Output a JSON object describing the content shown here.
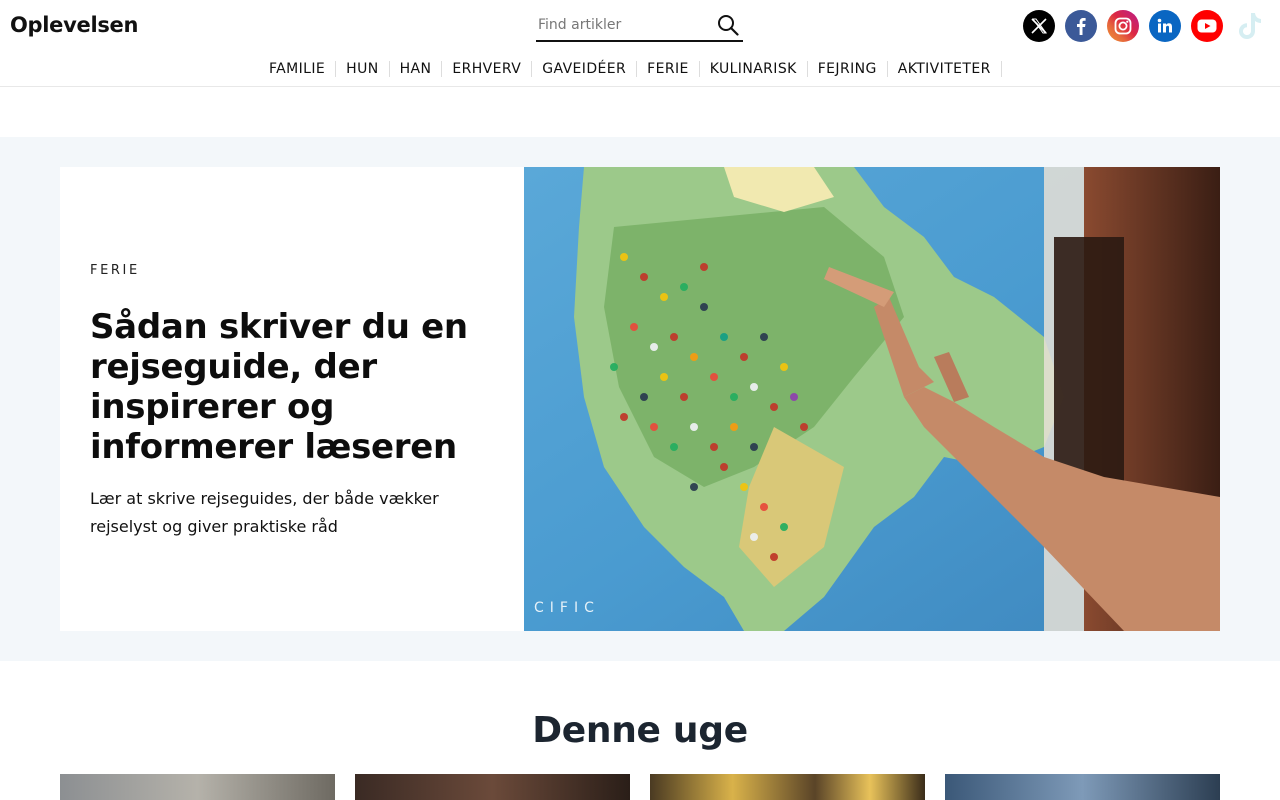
{
  "header": {
    "logo": "Oplevelsen",
    "search": {
      "placeholder": "Find artikler"
    },
    "social": [
      {
        "name": "x",
        "color": "#000000"
      },
      {
        "name": "facebook",
        "color": "#3b5998"
      },
      {
        "name": "instagram",
        "color": "#c13584"
      },
      {
        "name": "linkedin",
        "color": "#0a66c2"
      },
      {
        "name": "youtube",
        "color": "#ff0000"
      },
      {
        "name": "tiktok",
        "color": "#d6eef2"
      }
    ]
  },
  "nav": {
    "items": [
      "FAMILIE",
      "HUN",
      "HAN",
      "ERHVERV",
      "GAVEIDÉER",
      "FERIE",
      "KULINARISK",
      "FEJRING",
      "AKTIVITETER"
    ]
  },
  "hero": {
    "category": "FERIE",
    "title": "Sådan skriver du en rejseguide, der inspirerer og informerer læseren",
    "excerpt": "Lær at skrive rejseguides, der både vækker rejselyst og giver praktiske råd",
    "image_alt": "hand pointing at a world map covered with colored pins"
  },
  "section": {
    "title": "Denne uge"
  },
  "colors": {
    "hero_bg": "#f3f7fa",
    "text": "#111111",
    "section_title": "#1c2530"
  }
}
